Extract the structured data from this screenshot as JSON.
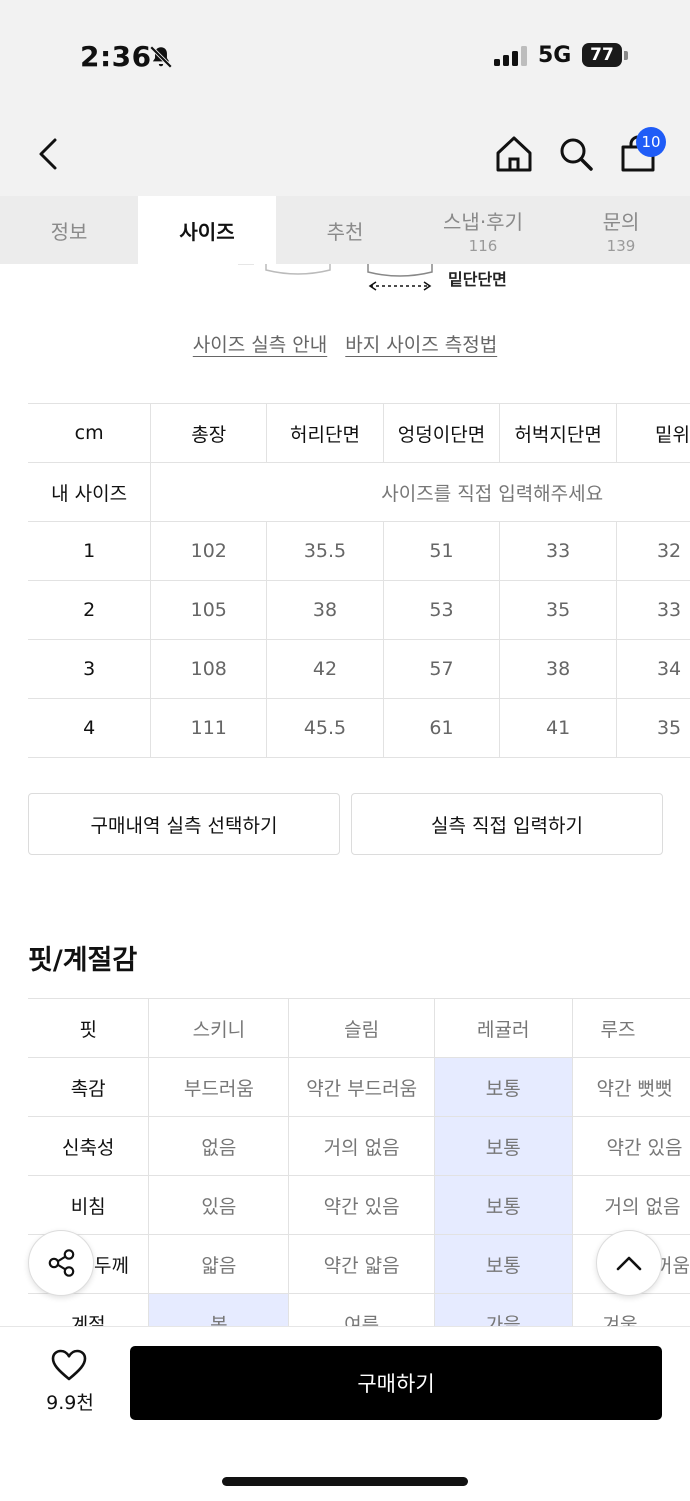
{
  "status_bar": {
    "time": "2:36",
    "network": "5G",
    "battery": "77"
  },
  "nav": {
    "cart_count": "10"
  },
  "tabs": [
    {
      "label": "정보",
      "count": ""
    },
    {
      "label": "사이즈",
      "count": ""
    },
    {
      "label": "추천",
      "count": ""
    },
    {
      "label": "스냅·후기",
      "count": "116"
    },
    {
      "label": "문의",
      "count": "139"
    }
  ],
  "diagram": {
    "label": "밑단단면"
  },
  "guide": {
    "size_guide_link": "사이즈 실측 안내",
    "measure_link": "바지 사이즈 측정법"
  },
  "size_table": {
    "headers": [
      "cm",
      "총장",
      "허리단면",
      "엉덩이단면",
      "허벅지단면",
      "밑위"
    ],
    "my_size_label": "내 사이즈",
    "my_size_placeholder": "사이즈를 직접 입력해주세요",
    "rows": [
      [
        "1",
        "102",
        "35.5",
        "51",
        "33",
        "32"
      ],
      [
        "2",
        "105",
        "38",
        "53",
        "35",
        "33"
      ],
      [
        "3",
        "108",
        "42",
        "57",
        "38",
        "34"
      ],
      [
        "4",
        "111",
        "45.5",
        "61",
        "41",
        "35"
      ]
    ]
  },
  "actions": {
    "history_button": "구매내역 실측 선택하기",
    "direct_input_button": "실측 직접 입력하기"
  },
  "fit": {
    "title": "핏/계절감",
    "rows": [
      {
        "label": "핏",
        "cells": [
          "스키니",
          "슬림",
          "레귤러",
          "루즈"
        ],
        "selected": []
      },
      {
        "label": "촉감",
        "cells": [
          "부드러움",
          "약간 부드러움",
          "보통",
          "약간 뻣뻣"
        ],
        "selected": [
          2
        ]
      },
      {
        "label": "신축성",
        "cells": [
          "없음",
          "거의 없음",
          "보통",
          "약간 있음"
        ],
        "selected": [
          2
        ]
      },
      {
        "label": "비침",
        "cells": [
          "있음",
          "약간 있음",
          "보통",
          "거의 없음"
        ],
        "selected": [
          2
        ]
      },
      {
        "label": "두께",
        "cells": [
          "얇음",
          "약간 얇음",
          "보통",
          "약간 두꺼움"
        ],
        "selected": [
          2
        ]
      },
      {
        "label": "계절",
        "cells": [
          "봄",
          "여름",
          "가을",
          "겨울"
        ],
        "selected": [
          0,
          2
        ]
      }
    ]
  },
  "bottom": {
    "like_count": "9.9천",
    "buy_button": "구매하기"
  }
}
